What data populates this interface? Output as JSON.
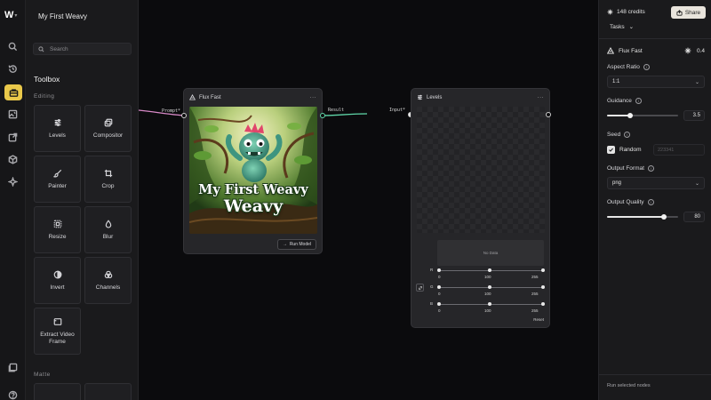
{
  "project": {
    "title": "My First Weavy"
  },
  "rail": {
    "items": [
      {
        "icon": "search-icon"
      },
      {
        "icon": "history-icon"
      },
      {
        "icon": "toolbox-icon",
        "active": true
      },
      {
        "icon": "image-edit-icon"
      },
      {
        "icon": "export-icon"
      },
      {
        "icon": "cube-icon"
      },
      {
        "icon": "sparkle-icon"
      },
      {
        "icon": "gallery-icon"
      },
      {
        "icon": "help-icon"
      }
    ]
  },
  "sidebar": {
    "search_placeholder": "Search",
    "toolbox_title": "Toolbox",
    "sections": {
      "editing": "Editing",
      "matte": "Matte"
    },
    "tools": [
      {
        "label": "Levels",
        "icon": "sliders-icon"
      },
      {
        "label": "Compositor",
        "icon": "layers-icon"
      },
      {
        "label": "Painter",
        "icon": "brush-icon"
      },
      {
        "label": "Crop",
        "icon": "crop-icon"
      },
      {
        "label": "Resize",
        "icon": "resize-icon"
      },
      {
        "label": "Blur",
        "icon": "drop-icon"
      },
      {
        "label": "Invert",
        "icon": "half-circle-icon"
      },
      {
        "label": "Channels",
        "icon": "channels-icon"
      },
      {
        "label": "Extract Video Frame",
        "icon": "video-frame-icon"
      }
    ]
  },
  "canvas": {
    "ports": {
      "prompt": "Prompt*",
      "result": "Result",
      "input": "Input*"
    },
    "flux_node": {
      "title": "Flux Fast",
      "menu": "...",
      "image_caption_line1": "My First Weavy",
      "image_caption_line2": "Weavy",
      "run_button": "Run Model"
    },
    "levels_node": {
      "title": "Levels",
      "menu": "...",
      "no_data": "No Data",
      "channels": [
        {
          "label": "R",
          "min": "0",
          "mid": "100",
          "max": "255"
        },
        {
          "label": "G",
          "min": "0",
          "mid": "100",
          "max": "255"
        },
        {
          "label": "B",
          "min": "0",
          "mid": "100",
          "max": "255"
        }
      ],
      "reset": "Reset"
    }
  },
  "panel": {
    "credits": "148 credits",
    "share": "Share",
    "tasks": "Tasks",
    "model_name": "Flux Fast",
    "model_cost": "0.4",
    "aspect_ratio_label": "Aspect Ratio",
    "aspect_ratio_value": "1:1",
    "guidance_label": "Guidance",
    "guidance_value": "3.5",
    "guidance_fraction": 0.33,
    "seed_label": "Seed",
    "seed_random_label": "Random",
    "seed_value": "223341",
    "output_format_label": "Output Format",
    "output_format_value": "png",
    "output_quality_label": "Output Quality",
    "output_quality_value": "80",
    "output_quality_fraction": 0.8,
    "run_selected": "Run selected nodes"
  },
  "colors": {
    "accent": "#e9c84a",
    "wire_prompt": "#d98ac8",
    "wire_result": "#5fd6a8"
  }
}
